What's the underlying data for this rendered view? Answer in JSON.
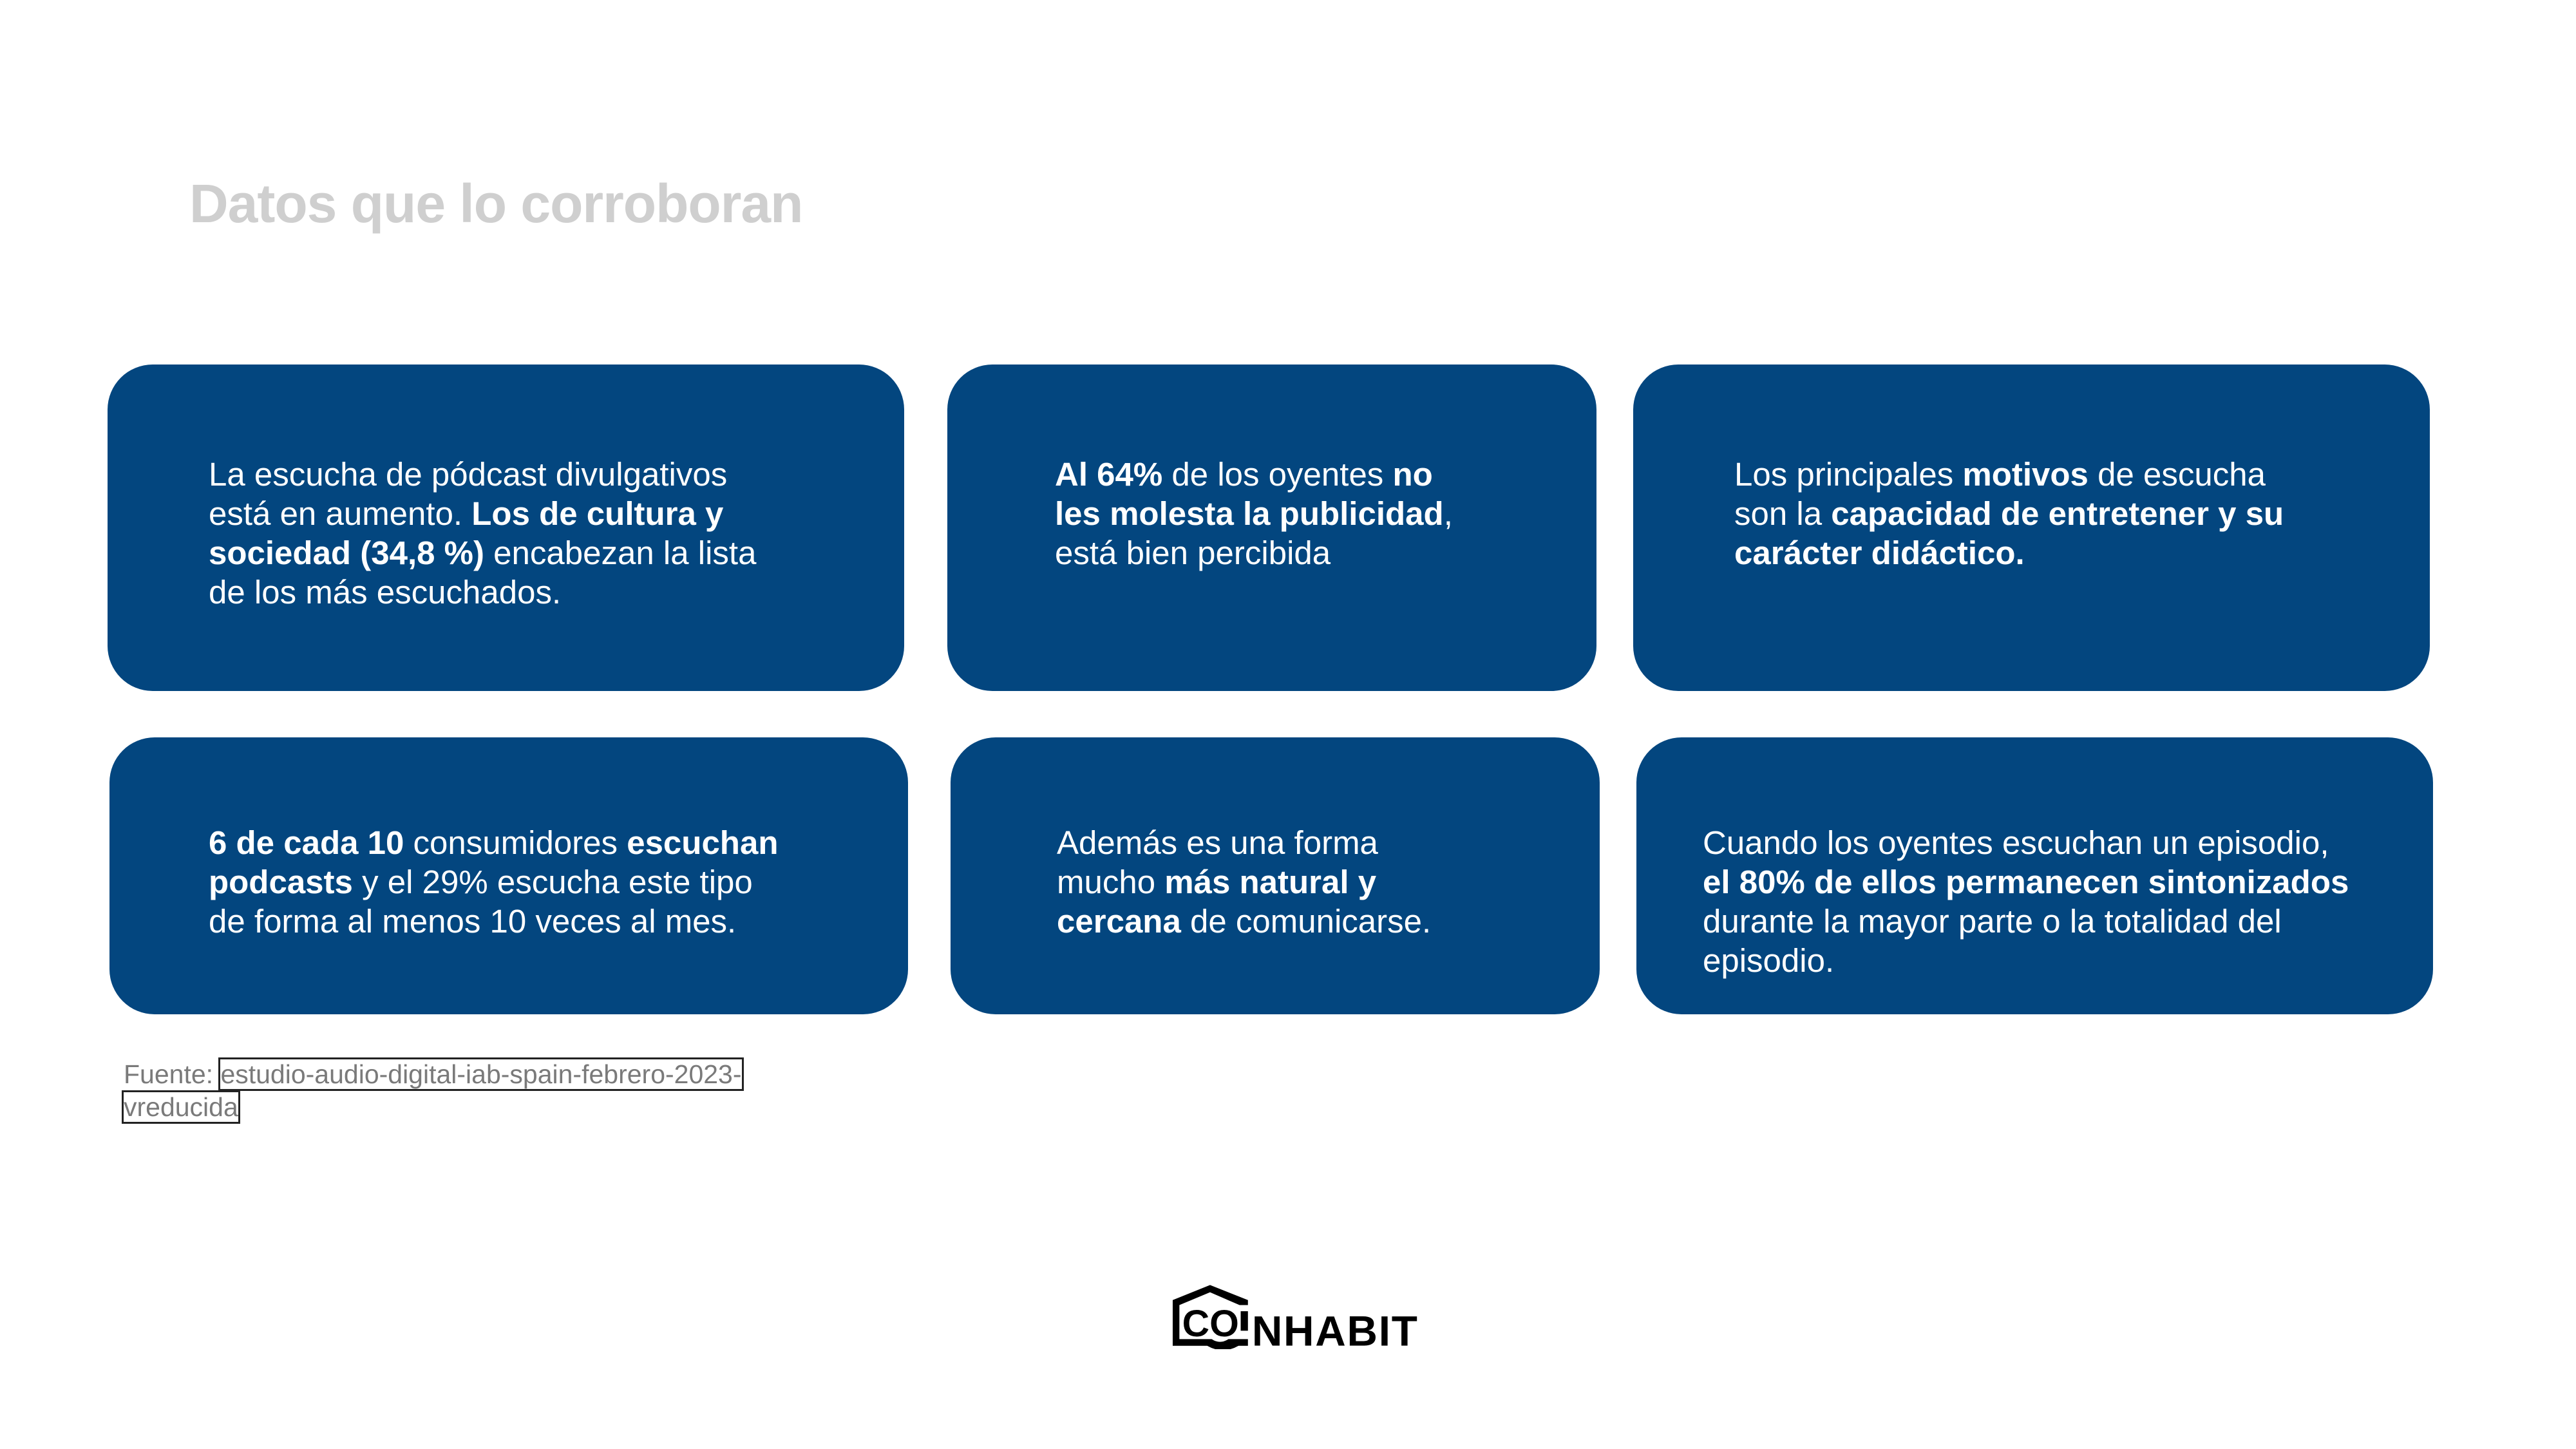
{
  "title": "Datos que lo corroboran",
  "accent_color": "#03467f",
  "cards": [
    {
      "lines": [
        [
          {
            "t": "La escucha de pódcast divulgativos",
            "b": false
          }
        ],
        [
          {
            "t": "está en aumento. ",
            "b": false
          },
          {
            "t": "Los de cultura y",
            "b": true
          }
        ],
        [
          {
            "t": "sociedad (34,8 %)",
            "b": true
          },
          {
            "t": " encabezan la lista",
            "b": false
          }
        ],
        [
          {
            "t": "de los más escuchados.",
            "b": false
          }
        ]
      ]
    },
    {
      "lines": [
        [
          {
            "t": "Al 64%",
            "b": true
          },
          {
            "t": " de los oyentes ",
            "b": false
          },
          {
            "t": "no",
            "b": true
          }
        ],
        [
          {
            "t": "les molesta la publicidad",
            "b": true
          },
          {
            "t": ",",
            "b": false
          }
        ],
        [
          {
            "t": "está bien percibida",
            "b": false
          }
        ]
      ]
    },
    {
      "lines": [
        [
          {
            "t": "Los principales ",
            "b": false
          },
          {
            "t": "motivos",
            "b": true
          },
          {
            "t": " de escucha",
            "b": false
          }
        ],
        [
          {
            "t": "son la ",
            "b": false
          },
          {
            "t": "capacidad de entretener y su",
            "b": true
          }
        ],
        [
          {
            "t": "carácter didáctico.",
            "b": true
          }
        ]
      ]
    },
    {
      "lines": [
        [
          {
            "t": "6 de cada 10",
            "b": true
          },
          {
            "t": " consumidores ",
            "b": false
          },
          {
            "t": "escuchan",
            "b": true
          }
        ],
        [
          {
            "t": "podcasts",
            "b": true
          },
          {
            "t": " y el 29% escucha este tipo",
            "b": false
          }
        ],
        [
          {
            "t": "de forma al menos 10 veces al mes.",
            "b": false
          }
        ]
      ]
    },
    {
      "lines": [
        [
          {
            "t": "Además es una forma",
            "b": false
          }
        ],
        [
          {
            "t": "mucho ",
            "b": false
          },
          {
            "t": "más natural y",
            "b": true
          }
        ],
        [
          {
            "t": "cercana",
            "b": true
          },
          {
            "t": " de comunicarse.",
            "b": false
          }
        ]
      ]
    },
    {
      "lines": [
        [
          {
            "t": "Cuando los oyentes escuchan un episodio,",
            "b": false
          }
        ],
        [
          {
            "t": "el 80% de ellos permanecen sintonizados",
            "b": true
          }
        ],
        [
          {
            "t": "durante la mayor parte o la totalidad del",
            "b": false
          }
        ],
        [
          {
            "t": "episodio.",
            "b": false
          }
        ]
      ]
    }
  ],
  "source": {
    "label": "Fuente: ",
    "link_line1": "estudio-audio-digital-iab-spain-febrero-2023-",
    "link_line2": "vreducida"
  },
  "logo": {
    "text": "COINHABIT"
  }
}
